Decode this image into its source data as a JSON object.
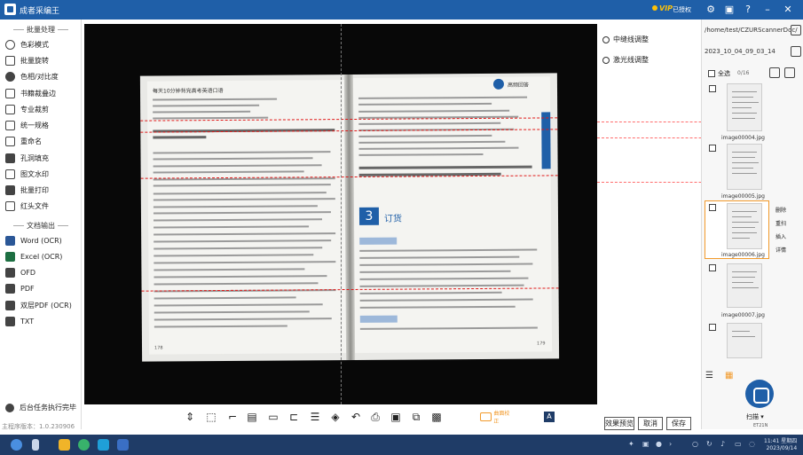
{
  "app": {
    "title": "成者采编王",
    "vip_label": "VIP",
    "auth_label": "已授权"
  },
  "sidebar": {
    "section_batch": "批量处理",
    "batch_items": [
      {
        "label": "色彩模式",
        "icon": "palette-icon"
      },
      {
        "label": "批量旋转",
        "icon": "rotate-icon"
      },
      {
        "label": "色相/对比度",
        "icon": "contrast-icon"
      },
      {
        "label": "书籍裁叠边",
        "icon": "book-crop-icon"
      },
      {
        "label": "专业裁剪",
        "icon": "crop-icon"
      },
      {
        "label": "统一规格",
        "icon": "uniform-size-icon"
      },
      {
        "label": "重命名",
        "icon": "rename-icon"
      },
      {
        "label": "孔洞填充",
        "icon": "fill-hole-icon"
      },
      {
        "label": "图文水印",
        "icon": "watermark-icon"
      },
      {
        "label": "批量打印",
        "icon": "print-icon"
      },
      {
        "label": "红头文件",
        "icon": "red-header-icon"
      }
    ],
    "section_output": "文档输出",
    "output_items": [
      {
        "label": "Word (OCR)",
        "icon": "word-icon"
      },
      {
        "label": "Excel (OCR)",
        "icon": "excel-icon"
      },
      {
        "label": "OFD",
        "icon": "ofd-icon"
      },
      {
        "label": "PDF",
        "icon": "pdf-icon"
      },
      {
        "label": "双层PDF (OCR)",
        "icon": "dual-pdf-icon"
      },
      {
        "label": "TXT",
        "icon": "txt-icon"
      }
    ],
    "background_task": "后台任务执行完毕",
    "version": "主程序版本：1.0.230906"
  },
  "viewer": {
    "left_header": "每天10分钟背完高考英语口语",
    "left_page_no": "178",
    "right_header": "高频回答",
    "right_chapter_no": "3",
    "right_chapter_title": "订货",
    "right_page_no": "179"
  },
  "adjust_options": {
    "mid_line": "中缝线调整",
    "laser_line": "激光线调整"
  },
  "right_panel": {
    "path": "/home/test/CZURScannerDoc/",
    "folder": "2023_10_04_09_03_14",
    "select_all": "全选",
    "count": "0/16",
    "thumbnails": [
      {
        "label": "image00004.jpg"
      },
      {
        "label": "image00005.jpg"
      },
      {
        "label": "image00006.jpg"
      },
      {
        "label": "image00007.jpg"
      }
    ],
    "context_menu": [
      "删除",
      "重扫",
      "插入",
      "详情"
    ],
    "scan_label": "扫描 ▾",
    "device": "ET21N"
  },
  "toolbar": {
    "active_tool": "曲面校正"
  },
  "buttons": {
    "preview": "效果预览",
    "cancel": "取消",
    "save": "保存"
  },
  "taskbar": {
    "time": "11:41 星期四",
    "date": "2023/09/14"
  },
  "colors": {
    "brand_blue": "#1f5fa8",
    "accent_orange": "#f29a2b",
    "guide_red": "#e01818"
  }
}
